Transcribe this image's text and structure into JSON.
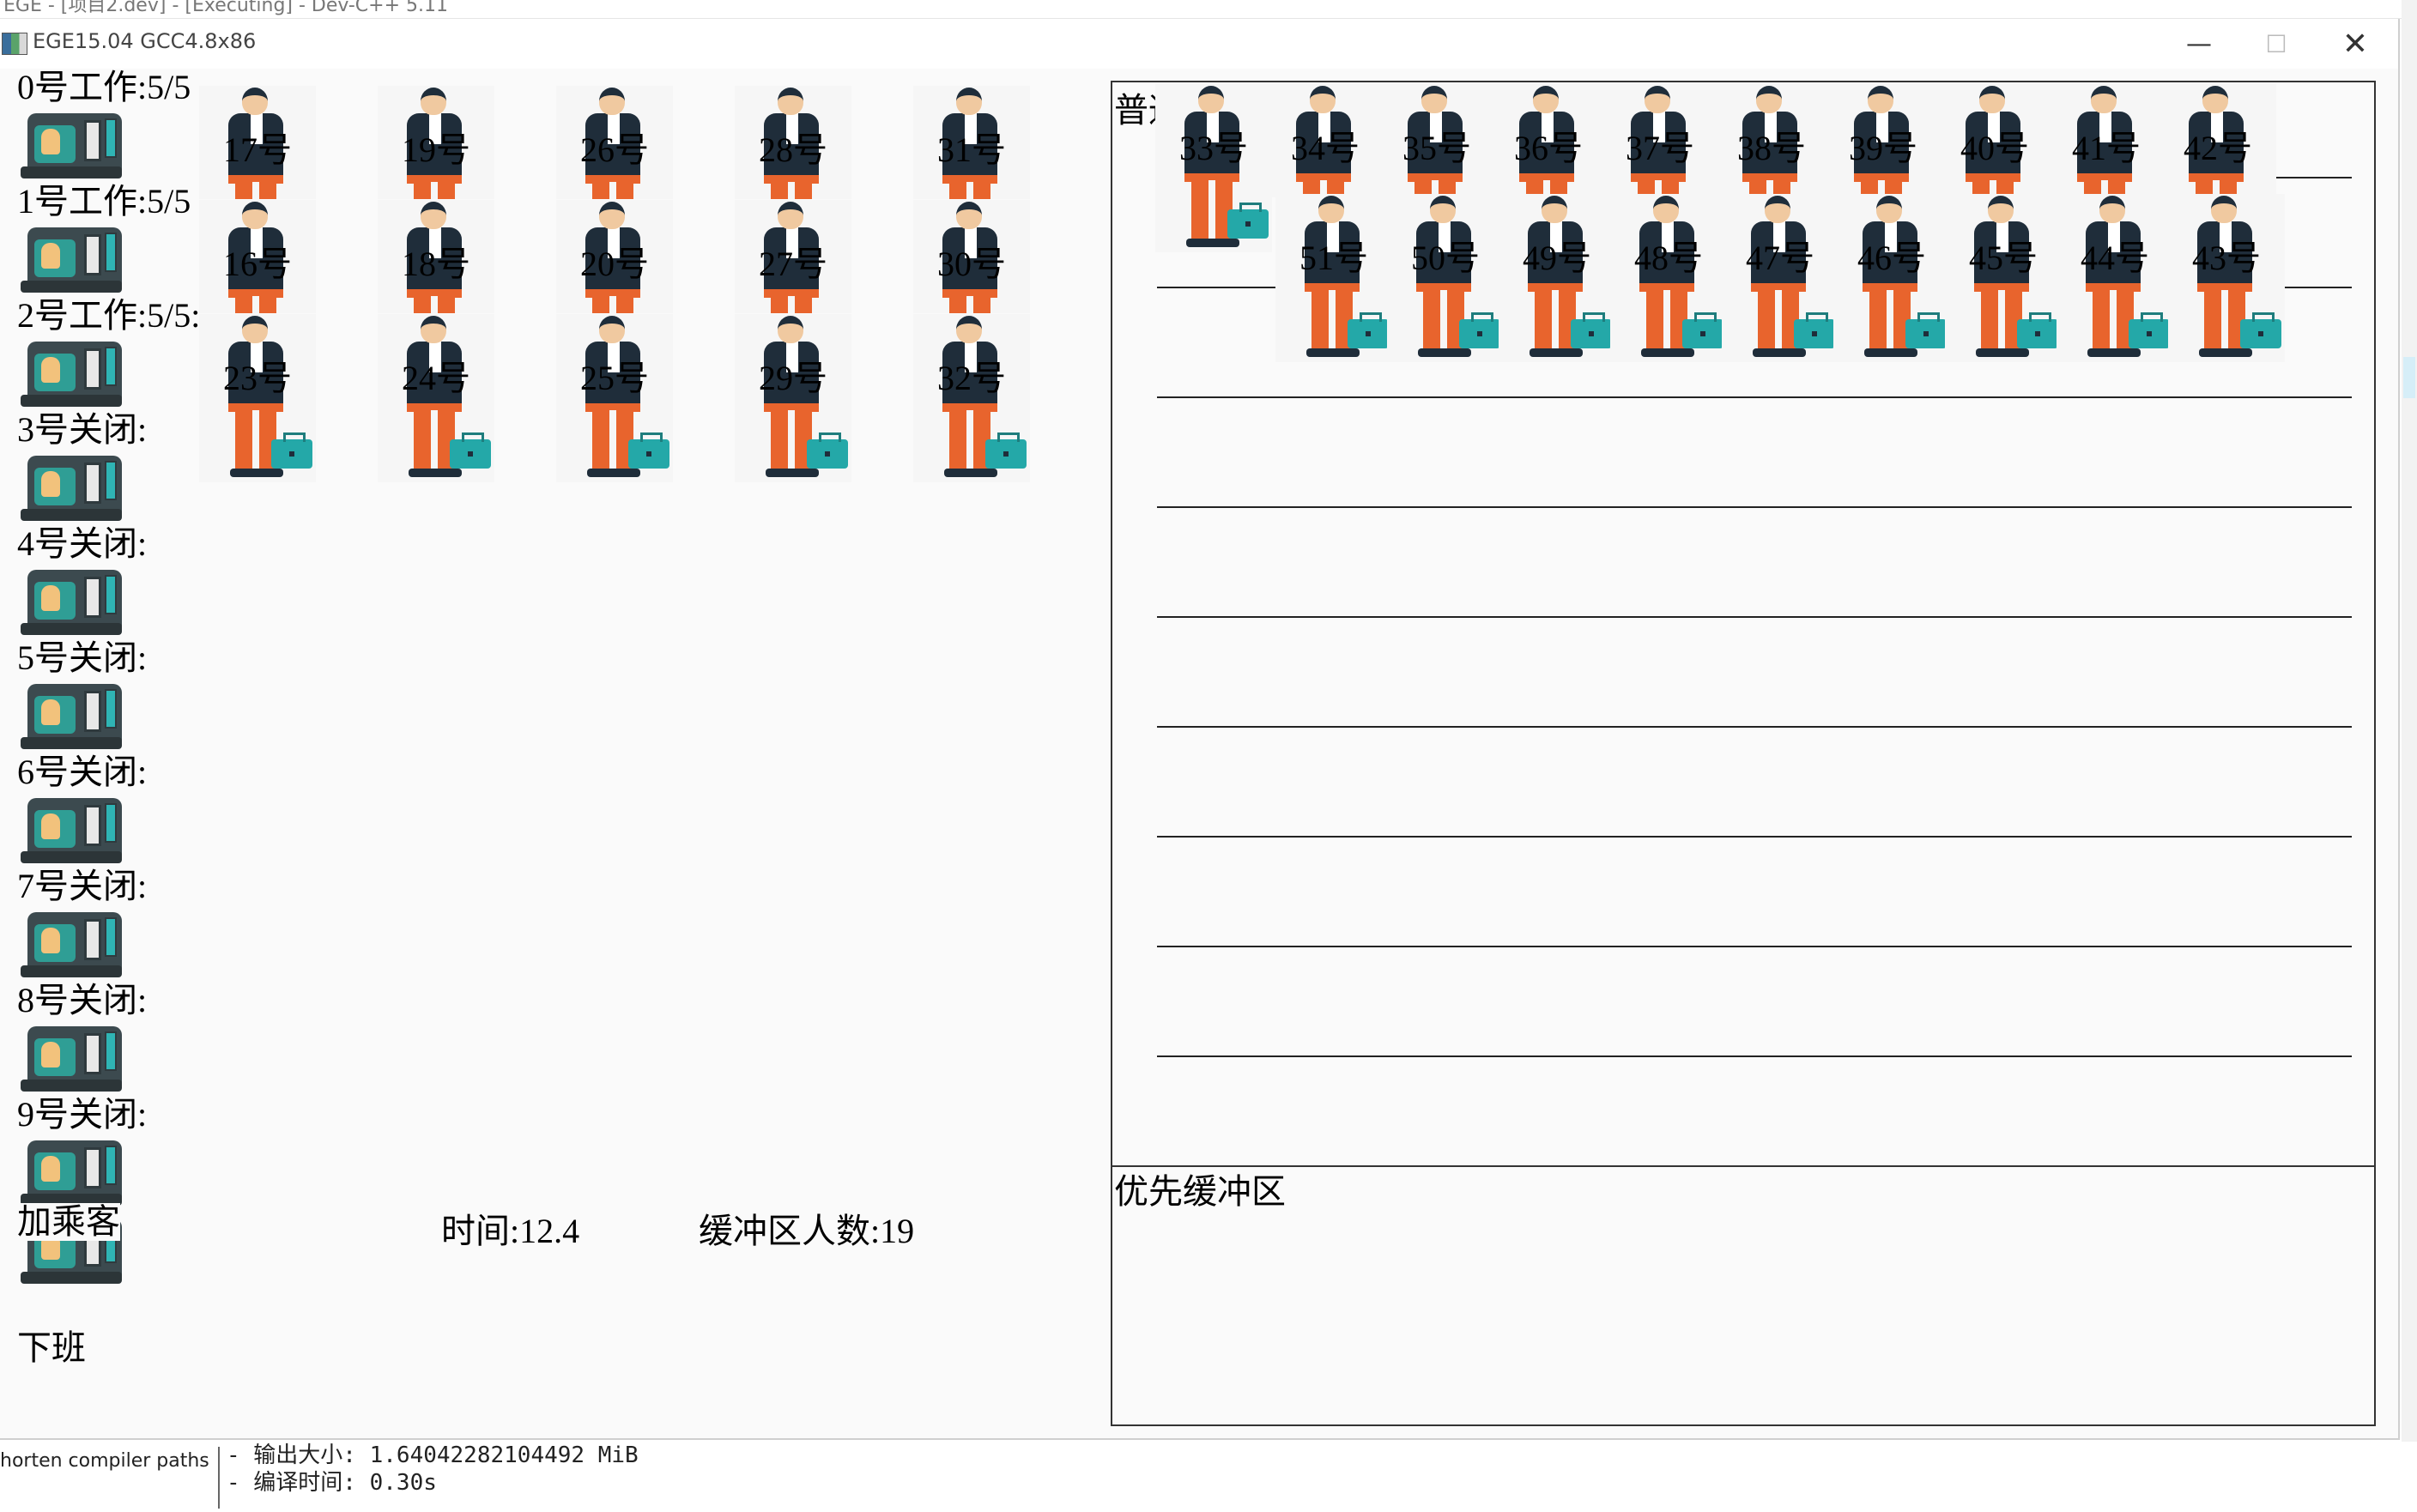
{
  "ide": {
    "title_fragment": "EGE - [项目2.dev] - [Executing] - Dev-C++ 5.11",
    "log_left": "horten compiler paths",
    "log_lines": [
      "- 输出大小: 1.64042282104492 MiB",
      "- 编译时间: 0.30s"
    ]
  },
  "window": {
    "title": "EGE15.04 GCC4.8x86",
    "minimize": "—",
    "maximize": "☐",
    "close": "✕"
  },
  "counters": [
    {
      "label": "0号工作:5/5"
    },
    {
      "label": "1号工作:5/5"
    },
    {
      "label": "2号工作:5/5:"
    },
    {
      "label": "3号关闭:"
    },
    {
      "label": "4号关闭:"
    },
    {
      "label": "5号关闭:"
    },
    {
      "label": "6号关闭:"
    },
    {
      "label": "7号关闭:"
    },
    {
      "label": "8号关闭:"
    },
    {
      "label": "9号关闭:"
    }
  ],
  "counter_queues": [
    [
      "17号",
      "19号",
      "26号",
      "28号",
      "31号"
    ],
    [
      "16号",
      "18号",
      "20号",
      "27号",
      "30号"
    ],
    [
      "23号",
      "24号",
      "25号",
      "29号",
      "32号"
    ]
  ],
  "status": {
    "time_label": "时间:",
    "time_value": "12.4",
    "buffer_label": "缓冲区人数:",
    "buffer_value": "19"
  },
  "controls": {
    "add_passenger": "加乘客",
    "off_work": "下班"
  },
  "normal_buffer": {
    "title": "普通缓冲区",
    "row1": [
      "33号",
      "34号",
      "35号",
      "36号",
      "37号",
      "38号",
      "39号",
      "40号",
      "41号",
      "42号"
    ],
    "row2": [
      "51号",
      "50号",
      "49号",
      "48号",
      "47号",
      "46号",
      "45号",
      "44号",
      "43号"
    ]
  },
  "priority_buffer": {
    "title": "优先缓冲区"
  }
}
